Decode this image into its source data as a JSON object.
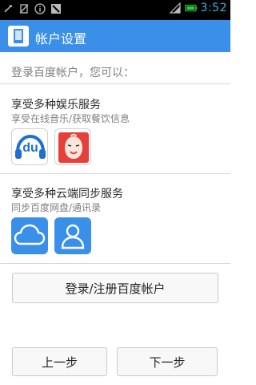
{
  "status_bar": {
    "time": "3:52",
    "icons": [
      "usb-icon",
      "no-sim-icon",
      "info-icon",
      "debug-icon",
      "signal-icon",
      "battery-icon"
    ]
  },
  "title_bar": {
    "title": "帐户设置",
    "icon": "account-app-icon"
  },
  "login_hint": "登录百度帐户，您可以：",
  "entertainment": {
    "title": "享受多种娱乐服务",
    "subtitle": "享受在线音乐/获取餐饮信息",
    "apps": [
      {
        "icon": "baidu-music-icon",
        "label": "du"
      },
      {
        "icon": "food-app-icon"
      }
    ]
  },
  "cloud": {
    "title": "享受多种云端同步服务",
    "subtitle": "同步百度网盘/通讯录",
    "apps": [
      {
        "icon": "cloud-drive-icon"
      },
      {
        "icon": "contacts-icon"
      }
    ]
  },
  "buttons": {
    "login": "登录/注册百度帐户",
    "prev": "上一步",
    "next": "下一步"
  },
  "colors": {
    "title_bar": "#3a8fe8",
    "status_time": "#33b5e5",
    "music_blue": "#1e6fd0",
    "food_red": "#e6403a",
    "cloud_blue": "#3a8fe8"
  }
}
